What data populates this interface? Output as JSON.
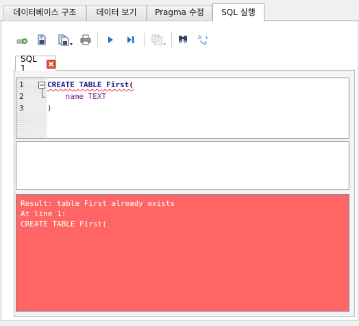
{
  "top_tabs": [
    {
      "label": "데이터베이스 구조"
    },
    {
      "label": "데이터 보기"
    },
    {
      "label": "Pragma 수정"
    },
    {
      "label": "SQL 실행"
    }
  ],
  "toolbar": {
    "icons": [
      "new-tab-icon",
      "open-file-icon",
      "save-icon",
      "print-icon",
      "execute-all-icon",
      "execute-line-icon",
      "save-results-icon",
      "find-icon",
      "find-replace-icon"
    ]
  },
  "editor_tab": {
    "label": "SQL 1"
  },
  "editor": {
    "line_numbers": [
      "1",
      "2",
      "3"
    ],
    "lines": [
      "CREATE TABLE First(",
      "    name TEXT",
      ")"
    ],
    "tokens": {
      "create": "CREATE",
      "table": "TABLE",
      "name": "First(",
      "col": "name",
      "type": "TEXT",
      "close": ")"
    }
  },
  "message": {
    "lines": [
      "Result: table First already exists",
      "At line 1:",
      "CREATE TABLE First("
    ],
    "bg_color": "#ff6565"
  },
  "colors": {
    "accent_close": "#e8502e",
    "execute": "#1e73c8"
  }
}
